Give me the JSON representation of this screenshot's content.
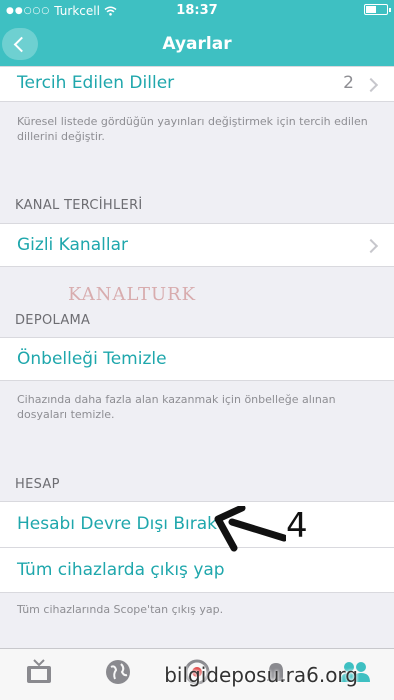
{
  "status": {
    "carrier": "Turkcell",
    "time": "18:37"
  },
  "nav": {
    "title": "Ayarlar"
  },
  "rows": {
    "languages": {
      "label": "Tercih Edilen Diller",
      "value": "2"
    },
    "languages_note": "Küresel listede gördüğün yayınları değiştirmek için tercih edilen dillerini değiştir.",
    "channels_header": "KANAL TERCİHLERİ",
    "hidden_channels": {
      "label": "Gizli Kanallar"
    },
    "storage_header": "DEPOLAMA",
    "clear_cache": {
      "label": "Önbelleği Temizle"
    },
    "clear_cache_note": "Cihazında daha fazla alan kazanmak için önbelleğe alınan dosyaları temizle.",
    "account_header": "HESAP",
    "deactivate": {
      "label": "Hesabı Devre Dışı Bırak"
    },
    "logout_all": {
      "label": "Tüm cihazlarda çıkış yap"
    },
    "logout_note": "Tüm cihazlarında Scope'tan çıkış yap."
  },
  "annotation": {
    "number": "4"
  },
  "watermark": {
    "text": "KANALTURK",
    "site": "bilgideposu.ra6.org"
  },
  "tabs": [
    {
      "icon": "tv-icon"
    },
    {
      "icon": "globe-icon"
    },
    {
      "icon": "broadcast-icon"
    },
    {
      "icon": "bell-icon"
    },
    {
      "icon": "people-icon"
    }
  ],
  "colors": {
    "accent": "#3ec0c2",
    "link": "#1fa7ac"
  }
}
